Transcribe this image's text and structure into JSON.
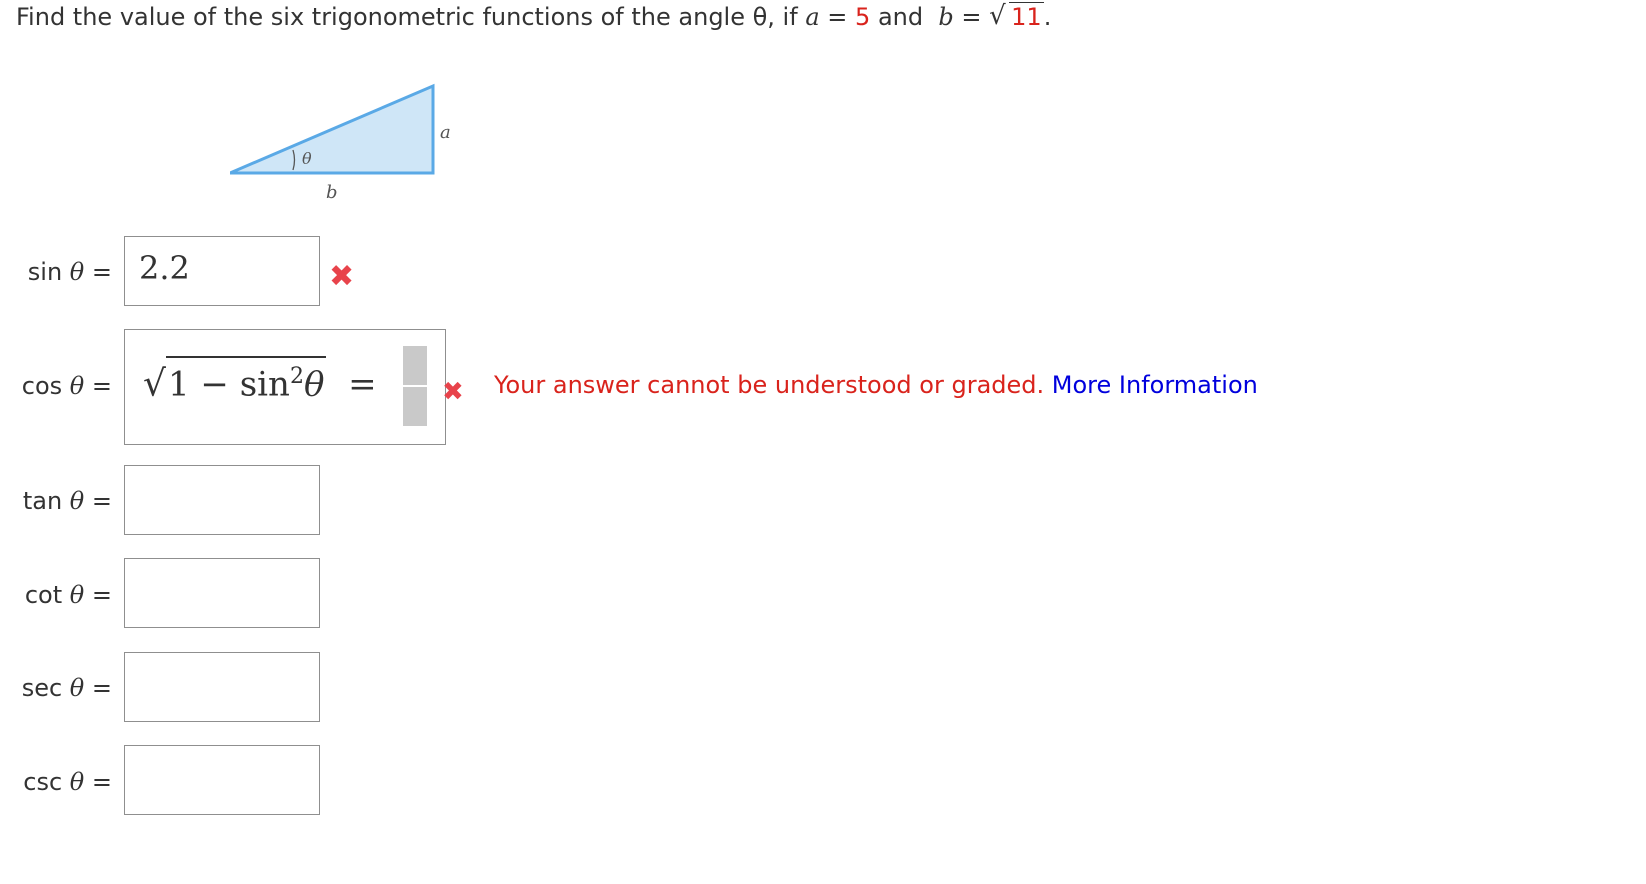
{
  "question": {
    "text_before": "Find the value of the six trigonometric functions of the angle θ, if",
    "a_label": "a",
    "equals": "=",
    "a_value": "5",
    "and": "and",
    "b_label": "b",
    "b_value": "11",
    "end": "."
  },
  "figure": {
    "angle_label": "θ",
    "side_a_label": "a",
    "side_b_label": "b",
    "fill_color": "#cfe6f7",
    "stroke_color": "#5aa9e6"
  },
  "rows": [
    {
      "fn": "sin",
      "var": "θ",
      "eq": "=",
      "value": "2.2",
      "status": "incorrect"
    },
    {
      "fn": "cos",
      "var": "θ",
      "eq": "=",
      "expr": {
        "one": "1",
        "minus": "−",
        "sin": "sin",
        "power": "2",
        "theta": "θ",
        "equals": "="
      },
      "status": "error"
    },
    {
      "fn": "tan",
      "var": "θ",
      "eq": "=",
      "value": ""
    },
    {
      "fn": "cot",
      "var": "θ",
      "eq": "=",
      "value": ""
    },
    {
      "fn": "sec",
      "var": "θ",
      "eq": "=",
      "value": ""
    },
    {
      "fn": "csc",
      "var": "θ",
      "eq": "=",
      "value": ""
    }
  ],
  "feedback": {
    "error_text": "Your answer cannot be understood or graded.",
    "link_text": "More Information",
    "error_color": "#d9231c",
    "link_color": "#0000dd",
    "x_icon": "x-mark-icon"
  }
}
